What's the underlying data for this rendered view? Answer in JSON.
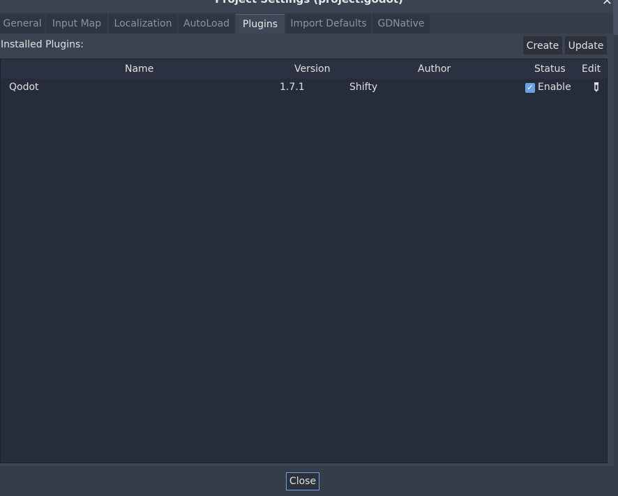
{
  "window": {
    "title": "Project Settings (project.godot)"
  },
  "tabs": [
    {
      "label": "General"
    },
    {
      "label": "Input Map"
    },
    {
      "label": "Localization"
    },
    {
      "label": "AutoLoad"
    },
    {
      "label": "Plugins"
    },
    {
      "label": "Import Defaults"
    },
    {
      "label": "GDNative"
    }
  ],
  "active_tab": "Plugins",
  "plugins": {
    "installed_label": "Installed Plugins:",
    "create_label": "Create",
    "update_label": "Update",
    "columns": {
      "name": "Name",
      "version": "Version",
      "author": "Author",
      "status": "Status",
      "edit": "Edit"
    },
    "rows": [
      {
        "name": "Qodot",
        "version": "1.7.1",
        "author": "Shifty",
        "status_label": "Enable",
        "enabled": true
      }
    ]
  },
  "footer": {
    "close_label": "Close"
  },
  "colors": {
    "accent": "#6ca3e8",
    "background": "#262c3a",
    "panel": "#363d4a"
  },
  "icons": {
    "window_close": "close-icon",
    "checkbox": "checkbox-checked-icon",
    "edit": "pencil-icon"
  }
}
